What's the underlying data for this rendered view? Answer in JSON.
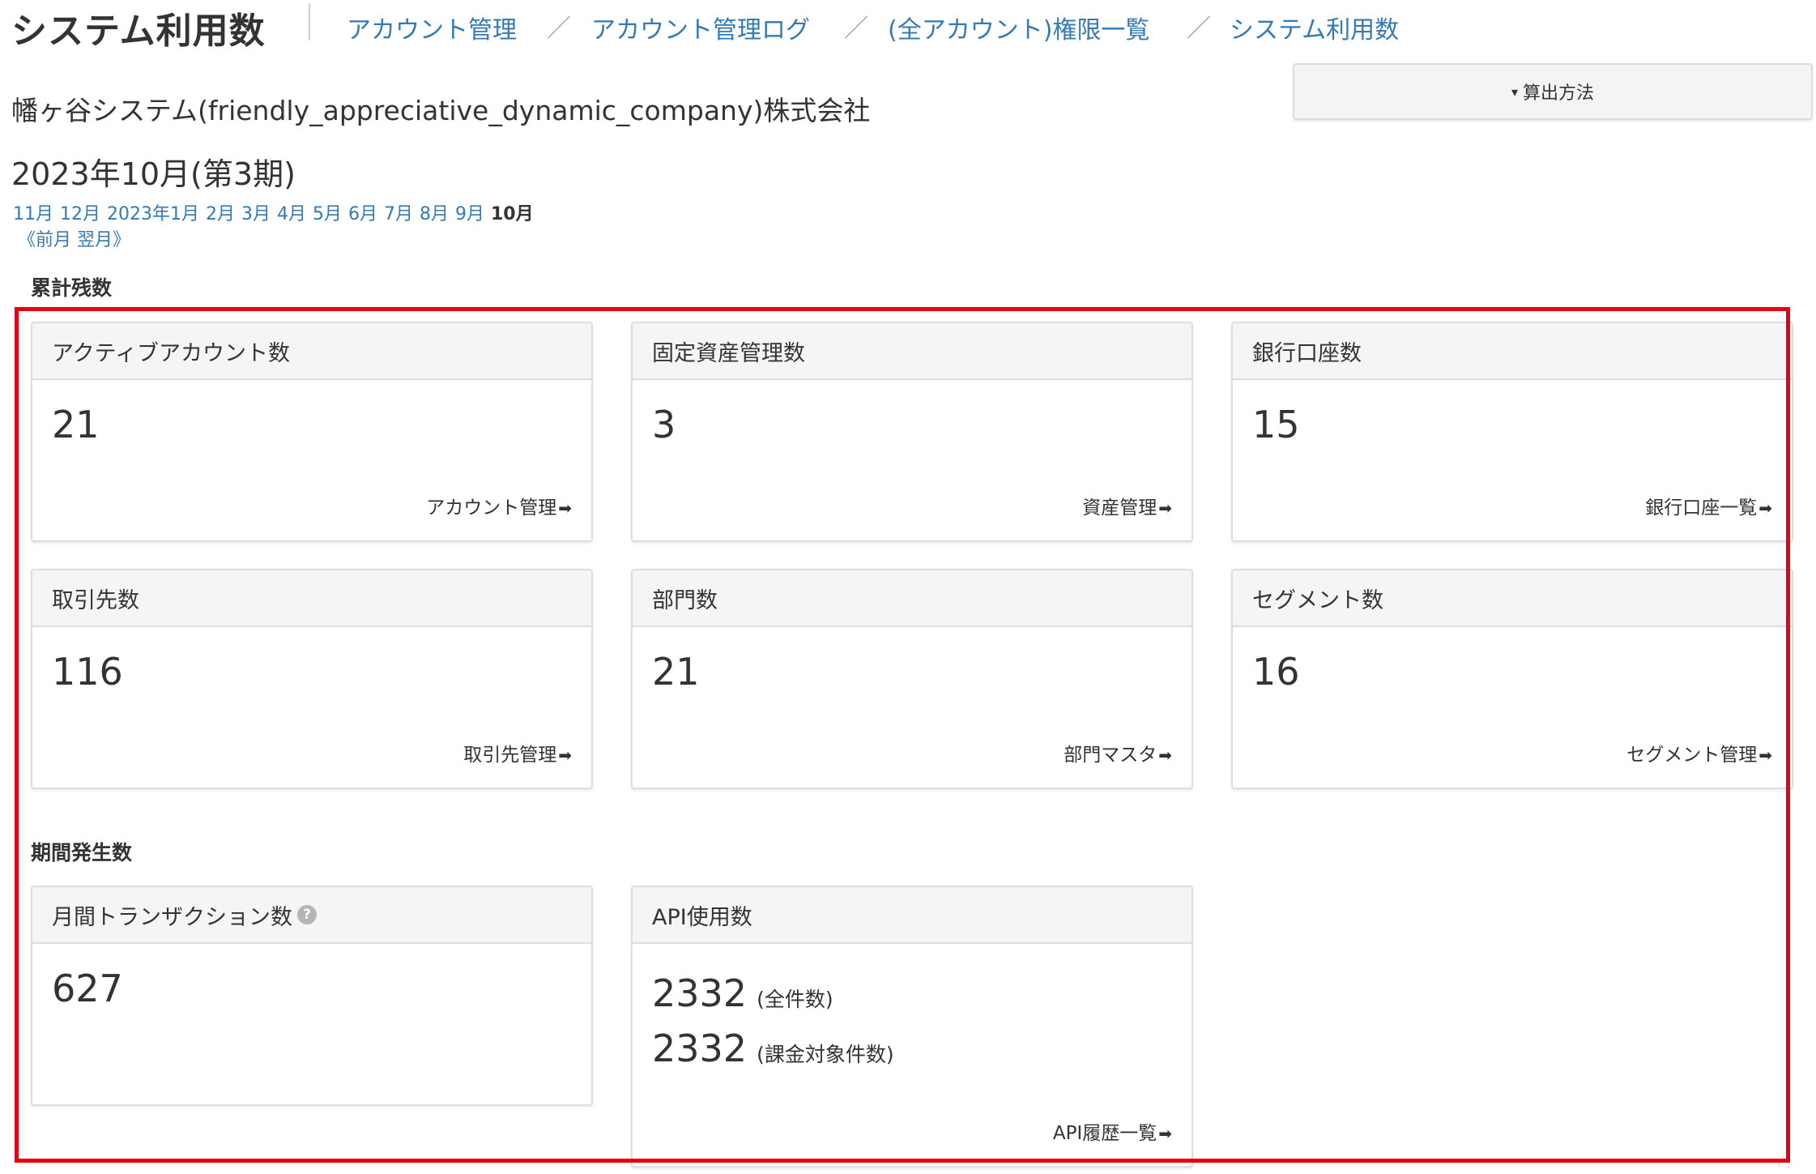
{
  "header": {
    "title": "システム利用数",
    "breadcrumbs": [
      "アカウント管理",
      "アカウント管理ログ",
      "(全アカウント)権限一覧",
      "システム利用数"
    ],
    "separator": "／"
  },
  "company_name": "幡ヶ谷システム(friendly_appreciative_dynamic_company)株式会社",
  "calc_button": {
    "caret": "▾",
    "label": "算出方法"
  },
  "period_label": "2023年10月(第3期)",
  "months": [
    "11月",
    "12月",
    "2023年1月",
    "2月",
    "3月",
    "4月",
    "5月",
    "6月",
    "7月",
    "8月",
    "9月"
  ],
  "current_month": "10月",
  "prev_next": {
    "left": "《",
    "prev": "前月",
    "next": "翌月",
    "right": "》"
  },
  "sections": {
    "cumulative": "累計残数",
    "period": "期間発生数"
  },
  "cards": {
    "active_accounts": {
      "title": "アクティブアカウント数",
      "value": "21",
      "link": "アカウント管理"
    },
    "fixed_assets": {
      "title": "固定資産管理数",
      "value": "3",
      "link": "資産管理"
    },
    "bank_accounts": {
      "title": "銀行口座数",
      "value": "15",
      "link": "銀行口座一覧"
    },
    "partners": {
      "title": "取引先数",
      "value": "116",
      "link": "取引先管理"
    },
    "departments": {
      "title": "部門数",
      "value": "21",
      "link": "部門マスタ"
    },
    "segments": {
      "title": "セグメント数",
      "value": "16",
      "link": "セグメント管理"
    },
    "monthly_transactions": {
      "title": "月間トランザクション数",
      "value": "627",
      "help": "?"
    },
    "api_usage": {
      "title": "API使用数",
      "total_value": "2332",
      "total_note": "(全件数)",
      "billable_value": "2332",
      "billable_note": "(課金対象件数)",
      "link": "API履歴一覧"
    }
  },
  "link_arrow": "➡",
  "colors": {
    "link": "#337ab7",
    "highlight_border": "#e60012",
    "card_header_bg": "#f5f5f5"
  }
}
